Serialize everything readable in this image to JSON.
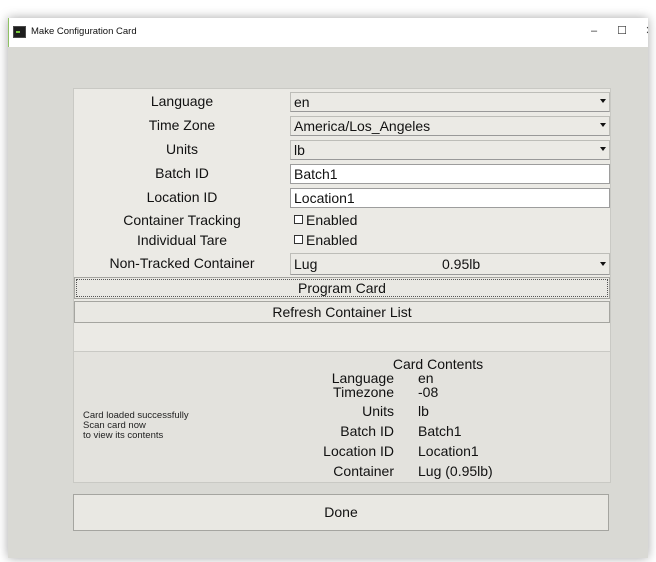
{
  "window": {
    "title": "Make Configuration Card",
    "minimize": "–",
    "maximize": "☐",
    "close": "✕"
  },
  "form": {
    "language": {
      "label": "Language",
      "value": "en"
    },
    "timezone": {
      "label": "Time Zone",
      "value": "America/Los_Angeles"
    },
    "units": {
      "label": "Units",
      "value": "lb"
    },
    "batch_id": {
      "label": "Batch ID",
      "value": "Batch1"
    },
    "location_id": {
      "label": "Location ID",
      "value": "Location1"
    },
    "container_tracking": {
      "label": "Container Tracking",
      "option": "Enabled",
      "checked": false
    },
    "individual_tare": {
      "label": "Individual Tare",
      "option": "Enabled",
      "checked": false
    },
    "non_tracked_container": {
      "label": "Non-Tracked Container",
      "name": "Lug",
      "weight": "0.95lb"
    }
  },
  "buttons": {
    "program_card": "Program Card",
    "refresh_containers": "Refresh Container List",
    "done": "Done"
  },
  "status": {
    "line1": "Card loaded successfully",
    "line2": "Scan card now",
    "line3": "to view its contents"
  },
  "card_contents": {
    "title": "Card Contents",
    "rows": [
      {
        "key": "Language",
        "value": "en"
      },
      {
        "key": "Timezone",
        "value": "-08"
      },
      {
        "key": "Units",
        "value": "lb"
      },
      {
        "key": "Batch ID",
        "value": "Batch1"
      },
      {
        "key": "Location ID",
        "value": "Location1"
      },
      {
        "key": "Container",
        "value": "Lug (0.95lb)"
      }
    ]
  }
}
